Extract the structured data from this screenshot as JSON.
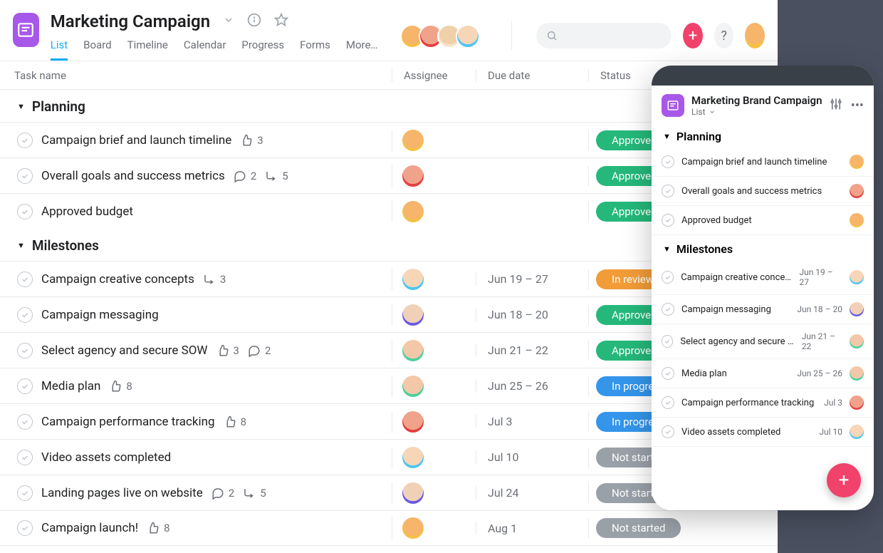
{
  "header": {
    "project_title": "Marketing Campaign",
    "tabs": [
      "List",
      "Board",
      "Timeline",
      "Calendar",
      "Progress",
      "Forms",
      "More…"
    ],
    "active_tab": 0
  },
  "collaborators": [
    {
      "color": "c-yellow"
    },
    {
      "color": "c-red"
    },
    {
      "color": "c-cream"
    },
    {
      "color": "c-blue"
    }
  ],
  "me_avatar_color": "c-yellow",
  "columns": {
    "task": "Task name",
    "assignee": "Assignee",
    "due": "Due date",
    "status": "Status"
  },
  "statuses": {
    "approved": {
      "label": "Approved",
      "color": "#25b87a"
    },
    "in_review": {
      "label": "In review",
      "color": "#f29c38"
    },
    "in_progress": {
      "label": "In progress",
      "color": "#3495ea"
    },
    "not_started": {
      "label": "Not started",
      "color": "#9aa0a8"
    }
  },
  "sections": [
    {
      "name": "Planning",
      "tasks": [
        {
          "name": "Campaign brief and launch timeline",
          "likes": 3,
          "comments": null,
          "subtasks": null,
          "assignee": "c-yellow",
          "due": "",
          "status": "approved"
        },
        {
          "name": "Overall goals and success metrics",
          "likes": null,
          "comments": 2,
          "subtasks": 5,
          "assignee": "c-red",
          "due": "",
          "status": "approved"
        },
        {
          "name": "Approved budget",
          "likes": null,
          "comments": null,
          "subtasks": null,
          "assignee": "c-yellow",
          "due": "",
          "status": "approved"
        }
      ]
    },
    {
      "name": "Milestones",
      "tasks": [
        {
          "name": "Campaign creative concepts",
          "likes": null,
          "comments": null,
          "subtasks": 3,
          "assignee": "c-blue",
          "due": "Jun 19 – 27",
          "status": "in_review"
        },
        {
          "name": "Campaign messaging",
          "likes": null,
          "comments": null,
          "subtasks": null,
          "assignee": "c-purple",
          "due": "Jun 18 – 20",
          "status": "approved"
        },
        {
          "name": "Select agency and secure SOW",
          "likes": 3,
          "comments": 2,
          "subtasks": null,
          "assignee": "c-green",
          "due": "Jun 21 – 22",
          "status": "approved"
        },
        {
          "name": "Media plan",
          "likes": 8,
          "comments": null,
          "subtasks": null,
          "assignee": "c-green",
          "due": "Jun 25 – 26",
          "status": "in_progress"
        },
        {
          "name": "Campaign performance tracking",
          "likes": 8,
          "comments": null,
          "subtasks": null,
          "assignee": "c-red",
          "due": "Jul 3",
          "status": "in_progress"
        },
        {
          "name": "Video assets completed",
          "likes": null,
          "comments": null,
          "subtasks": null,
          "assignee": "c-blue",
          "due": "Jul 10",
          "status": "not_started"
        },
        {
          "name": "Landing pages live on website",
          "likes": null,
          "comments": 2,
          "subtasks": 5,
          "assignee": "c-purple",
          "due": "Jul 24",
          "status": "not_started"
        },
        {
          "name": "Campaign launch!",
          "likes": 8,
          "comments": null,
          "subtasks": null,
          "assignee": "c-yellow",
          "due": "Aug 1",
          "status": "not_started"
        }
      ]
    }
  ],
  "mobile": {
    "title": "Marketing Brand Campaign",
    "subview": "List",
    "sections": [
      {
        "name": "Planning",
        "tasks": [
          {
            "name": "Campaign brief and launch timeline",
            "due": "",
            "assignee": "c-yellow"
          },
          {
            "name": "Overall goals and success metrics",
            "due": "",
            "assignee": "c-red"
          },
          {
            "name": "Approved budget",
            "due": "",
            "assignee": "c-yellow"
          }
        ]
      },
      {
        "name": "Milestones",
        "tasks": [
          {
            "name": "Campaign creative concepts",
            "due": "Jun 19 – 27",
            "assignee": "c-blue"
          },
          {
            "name": "Campaign messaging",
            "due": "Jun 18 – 20",
            "assignee": "c-purple"
          },
          {
            "name": "Select agency and secure SOW",
            "due": "Jun 21 – 22",
            "assignee": "c-green"
          },
          {
            "name": "Media plan",
            "due": "Jun 25 – 26",
            "assignee": "c-green"
          },
          {
            "name": "Campaign performance tracking",
            "due": "Jul 3",
            "assignee": "c-red"
          },
          {
            "name": "Video assets completed",
            "due": "Jul 10",
            "assignee": "c-blue"
          }
        ]
      }
    ]
  }
}
